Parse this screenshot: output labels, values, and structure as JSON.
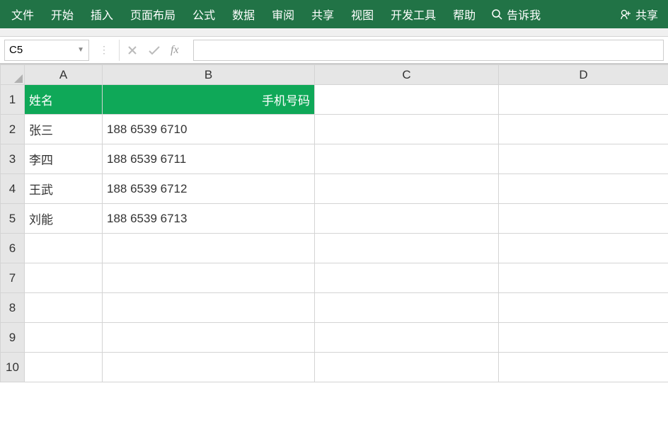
{
  "ribbon": {
    "tabs": [
      "文件",
      "开始",
      "插入",
      "页面布局",
      "公式",
      "数据",
      "审阅",
      "共享",
      "视图",
      "开发工具",
      "帮助"
    ],
    "tell_me": "告诉我",
    "share": "共享"
  },
  "formula_bar": {
    "name_box": "C5",
    "fx_label": "fx",
    "input_value": ""
  },
  "columns": [
    "A",
    "B",
    "C",
    "D"
  ],
  "rows": [
    "1",
    "2",
    "3",
    "4",
    "5",
    "6",
    "7",
    "8",
    "9",
    "10"
  ],
  "sheet": {
    "header": {
      "A": "姓名",
      "B": "手机号码"
    },
    "data": [
      {
        "A": "张三",
        "B": "188 6539 6710"
      },
      {
        "A": "李四",
        "B": "188 6539 6711"
      },
      {
        "A": "王武",
        "B": "188 6539 6712"
      },
      {
        "A": "刘能",
        "B": "188 6539 6713"
      }
    ]
  }
}
